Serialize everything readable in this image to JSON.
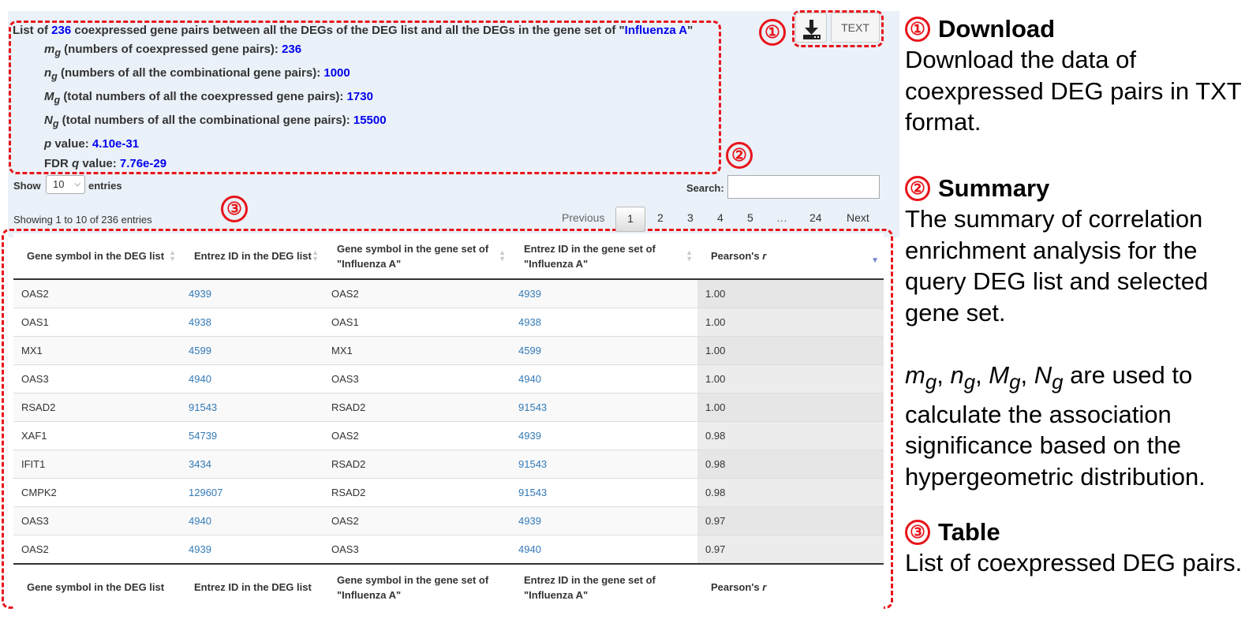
{
  "summary": {
    "title_pre": "List of ",
    "title_count": "236",
    "title_mid": " coexpressed gene pairs between all the DEGs of the DEG list and all the DEGs in the gene set of \"",
    "title_set": "Influenza A",
    "title_end": "\"",
    "mg_label": "(numbers of coexpressed gene pairs): ",
    "mg_value": "236",
    "ng_label": "(numbers of all the combinational gene pairs): ",
    "ng_value": "1000",
    "Mg_label": "(total numbers of all the coexpressed gene pairs): ",
    "Mg_value": "1730",
    "Ng_label": "(total numbers of all the combinational gene pairs): ",
    "Ng_value": "15500",
    "p_label": " value: ",
    "p_value": "4.10e-31",
    "q_label_pre": "FDR ",
    "q_label_post": " value: ",
    "q_value": "7.76e-29"
  },
  "symbols": {
    "m": "m",
    "n": "n",
    "M": "M",
    "N": "N",
    "g": "g",
    "p": "p",
    "q": "q"
  },
  "toolbar": {
    "text_button": "TEXT"
  },
  "controls": {
    "show": "Show",
    "entries_value": "10",
    "entries": "entries",
    "search": "Search:",
    "showing": "Showing 1 to 10 of 236 entries"
  },
  "pager": {
    "previous": "Previous",
    "pages": [
      "1",
      "2",
      "3",
      "4",
      "5",
      "…",
      "24"
    ],
    "next": "Next"
  },
  "table": {
    "headers": [
      "Gene symbol in the DEG list",
      "Entrez ID in the DEG list",
      "Gene symbol in the gene set of \"Influenza A\"",
      "Entrez ID in the gene set of \"Influenza A\"",
      "Pearson's "
    ],
    "r_symbol": "r",
    "rows": [
      [
        "OAS2",
        "4939",
        "OAS2",
        "4939",
        "1.00"
      ],
      [
        "OAS1",
        "4938",
        "OAS1",
        "4938",
        "1.00"
      ],
      [
        "MX1",
        "4599",
        "MX1",
        "4599",
        "1.00"
      ],
      [
        "OAS3",
        "4940",
        "OAS3",
        "4940",
        "1.00"
      ],
      [
        "RSAD2",
        "91543",
        "RSAD2",
        "91543",
        "1.00"
      ],
      [
        "XAF1",
        "54739",
        "OAS2",
        "4939",
        "0.98"
      ],
      [
        "IFIT1",
        "3434",
        "RSAD2",
        "91543",
        "0.98"
      ],
      [
        "CMPK2",
        "129607",
        "RSAD2",
        "91543",
        "0.98"
      ],
      [
        "OAS3",
        "4940",
        "OAS2",
        "4939",
        "0.97"
      ],
      [
        "OAS2",
        "4939",
        "OAS3",
        "4940",
        "0.97"
      ]
    ]
  },
  "callouts": {
    "one": "①",
    "two": "②",
    "three": "③"
  },
  "legend": {
    "download_title": "Download",
    "download_desc": "Download the data of coexpressed DEG pairs in TXT format.",
    "summary_title": "Summary",
    "summary_desc": "The summary of correlation enrichment analysis for the query DEG list and selected gene set.",
    "vars_desc": " are used to calculate the association significance based on the hypergeometric distribution.",
    "sep": ", ",
    "table_title": "Table",
    "table_desc": "List of coexpressed DEG pairs."
  },
  "colors": {
    "callout_red": "#e8141b",
    "value_blue": "#0000ee",
    "link_blue": "#337ab7",
    "panel_bg": "#eaf1f8"
  }
}
